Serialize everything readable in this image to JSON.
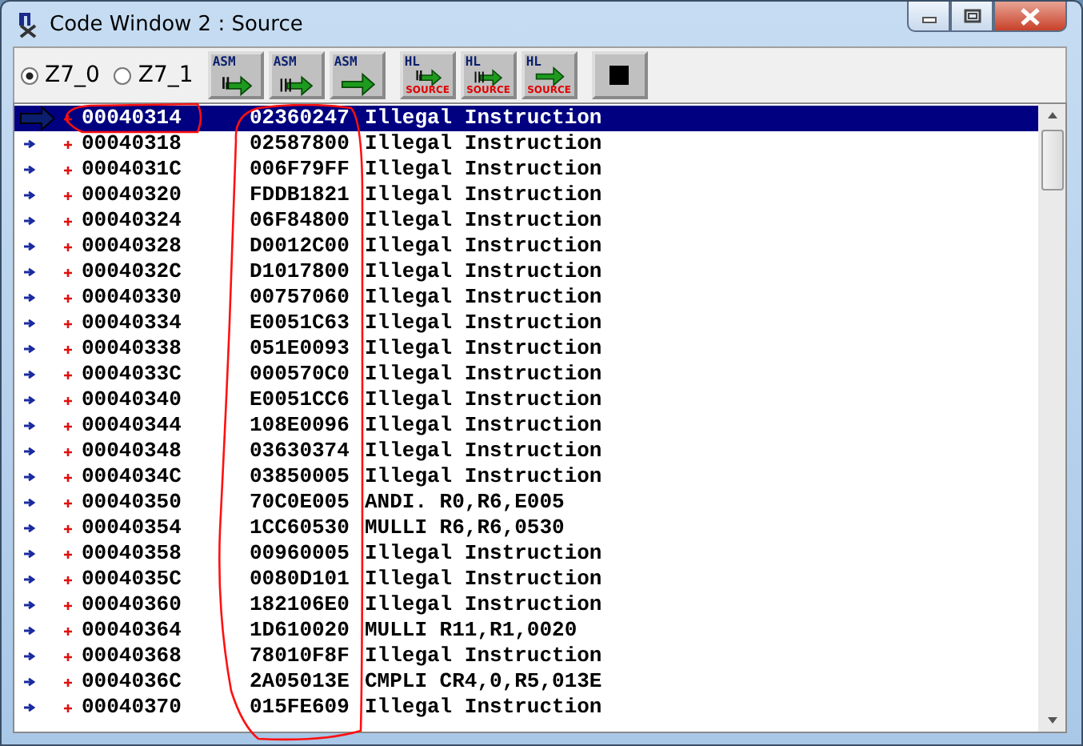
{
  "window": {
    "title": "Code Window 2 : Source"
  },
  "toolbar": {
    "radios": [
      {
        "label": "Z7_0",
        "selected": true
      },
      {
        "label": "Z7_1",
        "selected": false
      }
    ],
    "buttons": [
      {
        "kind": "asm_into",
        "label": "ASM"
      },
      {
        "kind": "asm_over",
        "label": "ASM"
      },
      {
        "kind": "asm_out",
        "label": "ASM"
      },
      {
        "kind": "hl_into",
        "label": "HL",
        "sublabel": "SOURCE"
      },
      {
        "kind": "hl_over",
        "label": "HL",
        "sublabel": "SOURCE"
      },
      {
        "kind": "hl_out",
        "label": "HL",
        "sublabel": "SOURCE"
      },
      {
        "kind": "stop"
      }
    ]
  },
  "rows": [
    {
      "address": "00040314",
      "opcode": "02360247",
      "instruction": "Illegal Instruction",
      "selected": true,
      "current": true
    },
    {
      "address": "00040318",
      "opcode": "02587800",
      "instruction": "Illegal Instruction",
      "selected": false,
      "current": false
    },
    {
      "address": "0004031C",
      "opcode": "006F79FF",
      "instruction": "Illegal Instruction",
      "selected": false,
      "current": false
    },
    {
      "address": "00040320",
      "opcode": "FDDB1821",
      "instruction": "Illegal Instruction",
      "selected": false,
      "current": false
    },
    {
      "address": "00040324",
      "opcode": "06F84800",
      "instruction": "Illegal Instruction",
      "selected": false,
      "current": false
    },
    {
      "address": "00040328",
      "opcode": "D0012C00",
      "instruction": "Illegal Instruction",
      "selected": false,
      "current": false
    },
    {
      "address": "0004032C",
      "opcode": "D1017800",
      "instruction": "Illegal Instruction",
      "selected": false,
      "current": false
    },
    {
      "address": "00040330",
      "opcode": "00757060",
      "instruction": "Illegal Instruction",
      "selected": false,
      "current": false
    },
    {
      "address": "00040334",
      "opcode": "E0051C63",
      "instruction": "Illegal Instruction",
      "selected": false,
      "current": false
    },
    {
      "address": "00040338",
      "opcode": "051E0093",
      "instruction": "Illegal Instruction",
      "selected": false,
      "current": false
    },
    {
      "address": "0004033C",
      "opcode": "000570C0",
      "instruction": "Illegal Instruction",
      "selected": false,
      "current": false
    },
    {
      "address": "00040340",
      "opcode": "E0051CC6",
      "instruction": "Illegal Instruction",
      "selected": false,
      "current": false
    },
    {
      "address": "00040344",
      "opcode": "108E0096",
      "instruction": "Illegal Instruction",
      "selected": false,
      "current": false
    },
    {
      "address": "00040348",
      "opcode": "03630374",
      "instruction": "Illegal Instruction",
      "selected": false,
      "current": false
    },
    {
      "address": "0004034C",
      "opcode": "03850005",
      "instruction": "Illegal Instruction",
      "selected": false,
      "current": false
    },
    {
      "address": "00040350",
      "opcode": "70C0E005",
      "instruction": "ANDI. R0,R6,E005",
      "selected": false,
      "current": false
    },
    {
      "address": "00040354",
      "opcode": "1CC60530",
      "instruction": "MULLI R6,R6,0530",
      "selected": false,
      "current": false
    },
    {
      "address": "00040358",
      "opcode": "00960005",
      "instruction": "Illegal Instruction",
      "selected": false,
      "current": false
    },
    {
      "address": "0004035C",
      "opcode": "0080D101",
      "instruction": "Illegal Instruction",
      "selected": false,
      "current": false
    },
    {
      "address": "00040360",
      "opcode": "182106E0",
      "instruction": "Illegal Instruction",
      "selected": false,
      "current": false
    },
    {
      "address": "00040364",
      "opcode": "1D610020",
      "instruction": "MULLI R11,R1,0020",
      "selected": false,
      "current": false
    },
    {
      "address": "00040368",
      "opcode": "78010F8F",
      "instruction": "Illegal Instruction",
      "selected": false,
      "current": false
    },
    {
      "address": "0004036C",
      "opcode": "2A05013E",
      "instruction": "CMPLI CR4,0,R5,013E",
      "selected": false,
      "current": false
    },
    {
      "address": "00040370",
      "opcode": "015FE609",
      "instruction": "Illegal Instruction",
      "selected": false,
      "current": false
    }
  ]
}
